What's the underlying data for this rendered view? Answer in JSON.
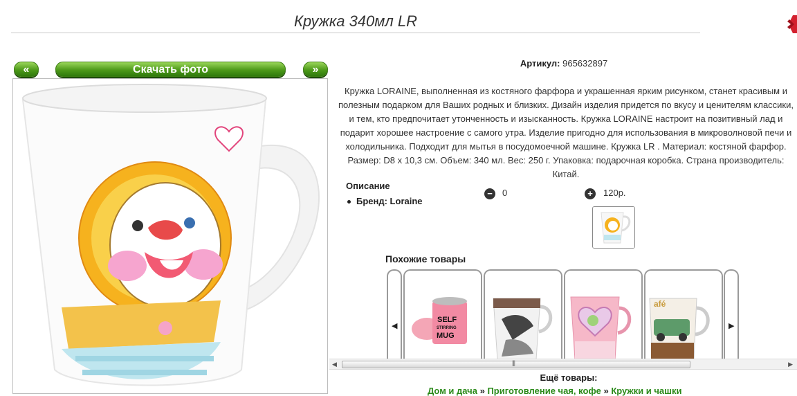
{
  "page_title": "Кружка 340мл LR",
  "nav": {
    "prev_label": "«",
    "next_label": "»",
    "download_label": "Скачать фото"
  },
  "article": {
    "label": "Артикул:",
    "value": "965632897"
  },
  "description": "Кружка LORAINE, выполненная из костяного фарфора и украшенная ярким рисунком, станет красивым и полезным подарком для Ваших родных и близких. Дизайн изделия придется по вкусу и ценителям классики, и тем, кто предпочитает утонченность и изысканность. Кружка LORAINE настроит на позитивный лад и подарит хорошее настроение с самого утра. Изделие пригодно для использования в микроволновой печи и холодильника. Подходит для мытья в посудомоечной машине. Кружка LR . Материал: костяной фарфор. Размер: D8 x 10,3 см. Объем: 340 мл. Вес: 250 г. Упаковка: подарочная коробка. Страна производитель: Китай.",
  "specs": {
    "title": "Описание",
    "brand": "Бренд: Loraine"
  },
  "cart": {
    "minus_icon": "minus-circle-icon",
    "plus_icon": "plus-circle-icon",
    "quantity": "0",
    "price": "120р."
  },
  "similar": {
    "title": "Похожие товары",
    "items": [
      {
        "name": "self-stirring-mug",
        "text": "SELF STIRRING MUG"
      },
      {
        "name": "fashion-mug",
        "text": ""
      },
      {
        "name": "heart-mug",
        "text": ""
      },
      {
        "name": "car-mug",
        "text": ""
      }
    ]
  },
  "more": {
    "title": "Ещё товары:",
    "crumb1": "Дом и дача",
    "sep": " » ",
    "crumb2": "Приготовление чая, кофе",
    "crumb3": "Кружки и чашки"
  },
  "colors": {
    "button_green": "#4d9a1a",
    "link_green": "#2b8a1a",
    "accent_red": "#d3202e"
  }
}
